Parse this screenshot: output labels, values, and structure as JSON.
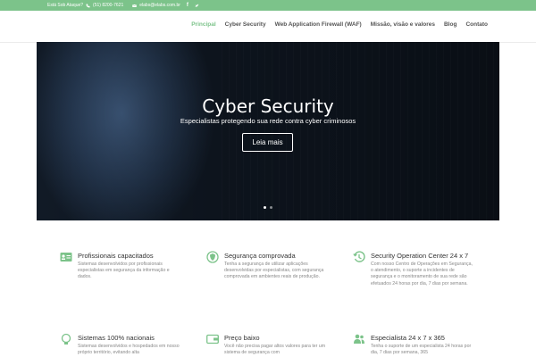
{
  "topbar": {
    "attack": "Está Sob Ataque?",
    "phone": "(51) 8200-7621",
    "email": "elabs@elabs.com.br",
    "social_facebook": "f",
    "social_twitter": "t",
    "bg_color": "#7cc38a"
  },
  "nav": {
    "items": [
      {
        "label": "Principal",
        "active": true
      },
      {
        "label": "Cyber Security",
        "active": false
      },
      {
        "label": "Web Application Firewall (WAF)",
        "active": false
      },
      {
        "label": "Missão, visão e valores",
        "active": false
      },
      {
        "label": "Blog",
        "active": false
      },
      {
        "label": "Contato",
        "active": false
      }
    ],
    "active_color": "#7cc38a"
  },
  "hero": {
    "title": "Cyber Security",
    "subtitle": "Especialistas protegendo sua rede contra cyber criminosos",
    "button": "Leia mais",
    "slides": 2,
    "active_slide": 1
  },
  "features": [
    {
      "icon": "id-card-icon",
      "title": "Profissionais capacitados",
      "text": "Sistemas desenvolvidos por profissionais especialistas em segurança da informação e dados."
    },
    {
      "icon": "shield-icon",
      "title": "Segurança comprovada",
      "text": "Tenha a segurança de utilizar aplicações desenvolvidas por especialistas, com segurança comprovada em ambientes reais de produção."
    },
    {
      "icon": "history-clock-icon",
      "title": "Security Operation Center 24 x 7",
      "text": "Com nosso Centro de Operações em Segurança, o atendimento, o suporte a incidentes de segurança e o monitoramento de sua rede são efetuados 24 horas por dia, 7 dias por semana."
    },
    {
      "icon": "lightbulb-icon",
      "title": "Sistemas 100% nacionais",
      "text": "Sistemas desenvolvidos e hospedados em nosso próprio território, evitando alta"
    },
    {
      "icon": "wallet-icon",
      "title": "Preço baixo",
      "text": "Você não precisa pagar altos valores para ter um sistema de segurança com"
    },
    {
      "icon": "users-icon",
      "title": "Especialista 24 x 7 x 365",
      "text": "Tenha o suporte de um especialista 24 horas por dia, 7 dias por semana, 365"
    }
  ],
  "icon_color": "#7cc38a"
}
